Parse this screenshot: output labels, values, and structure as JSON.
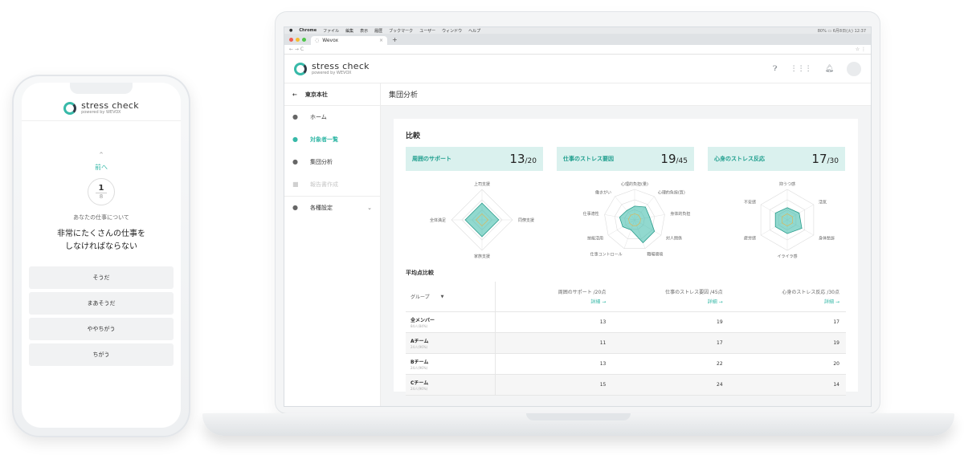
{
  "phone": {
    "logo": {
      "title": "stress check",
      "sub": "powered by WEVOX"
    },
    "prev_label": "前へ",
    "question_number": "1",
    "question_total": "8",
    "question_category": "あなたの仕事について",
    "question_text_line1": "非常にたくさんの仕事を",
    "question_text_line2": "しなければならない",
    "answers": [
      "そうだ",
      "まあそうだ",
      "ややちがう",
      "ちがう"
    ]
  },
  "browser": {
    "menubar": [
      "Chrome",
      "ファイル",
      "編集",
      "表示",
      "履歴",
      "ブックマーク",
      "ユーザー",
      "ウィンドウ",
      "ヘルプ"
    ],
    "menubar_right": "80% ▭ 6月8日(火) 12:37",
    "tab_title": "Wevox",
    "tab_close": "×",
    "tab_plus": "+",
    "nav_text": "←   →   C",
    "addr_icons": "☆   ⋮"
  },
  "app": {
    "logo": {
      "title": "stress check",
      "sub": "powered by WEVOX"
    },
    "org_name": "東京本社",
    "sidebar": [
      {
        "label": "ホーム",
        "icon": "person-icon",
        "state": "normal"
      },
      {
        "label": "対象者一覧",
        "icon": "person-icon",
        "state": "active"
      },
      {
        "label": "集団分析",
        "icon": "person-icon",
        "state": "normal"
      },
      {
        "label": "報告書作成",
        "icon": "document-icon",
        "state": "disabled"
      },
      {
        "label": "各種設定",
        "icon": "person-icon",
        "state": "normal"
      }
    ],
    "page_title": "集団分析",
    "comparison_title": "比較",
    "scores": [
      {
        "label": "周囲のサポート",
        "value": "13",
        "max": "/20"
      },
      {
        "label": "仕事のストレス要因",
        "value": "19",
        "max": "/45"
      },
      {
        "label": "心身のストレス反応",
        "value": "17",
        "max": "/30"
      }
    ],
    "radar_labels": [
      [
        "上司支援",
        "同僚支援",
        "家族支援",
        "全体満足"
      ],
      [
        "心理的負担(量)",
        "心理的負担(質)",
        "身体的負担",
        "対人関係",
        "職場環境",
        "仕事コントロール",
        "技能活用",
        "仕事適性",
        "働きがい"
      ],
      [
        "抑うつ感",
        "活気",
        "身体愁訴",
        "イライラ感",
        "疲労感",
        "不安感"
      ]
    ],
    "avg_title": "平均点比較",
    "table": {
      "group_label": "グループ",
      "group_dropdown": "▼",
      "columns": [
        {
          "label": "周囲のサポート /20点",
          "link": "詳細 →"
        },
        {
          "label": "仕事のストレス要因 /45点",
          "link": "詳細 →"
        },
        {
          "label": "心身のストレス反応 /30点",
          "link": "詳細 →"
        }
      ],
      "rows": [
        {
          "name": "全メンバー",
          "sub": "84人(84%)",
          "values": [
            "13",
            "19",
            "17"
          ]
        },
        {
          "name": "Aチーム",
          "sub": "24人(96%)",
          "values": [
            "11",
            "17",
            "19"
          ]
        },
        {
          "name": "Bチーム",
          "sub": "24人(96%)",
          "values": [
            "13",
            "22",
            "20"
          ]
        },
        {
          "name": "Cチーム",
          "sub": "24人(96%)",
          "values": [
            "15",
            "24",
            "14"
          ]
        }
      ]
    }
  },
  "colors": {
    "accent": "#37b9a8",
    "accent_light": "#daf1ee",
    "dark": "#2f3a45"
  }
}
